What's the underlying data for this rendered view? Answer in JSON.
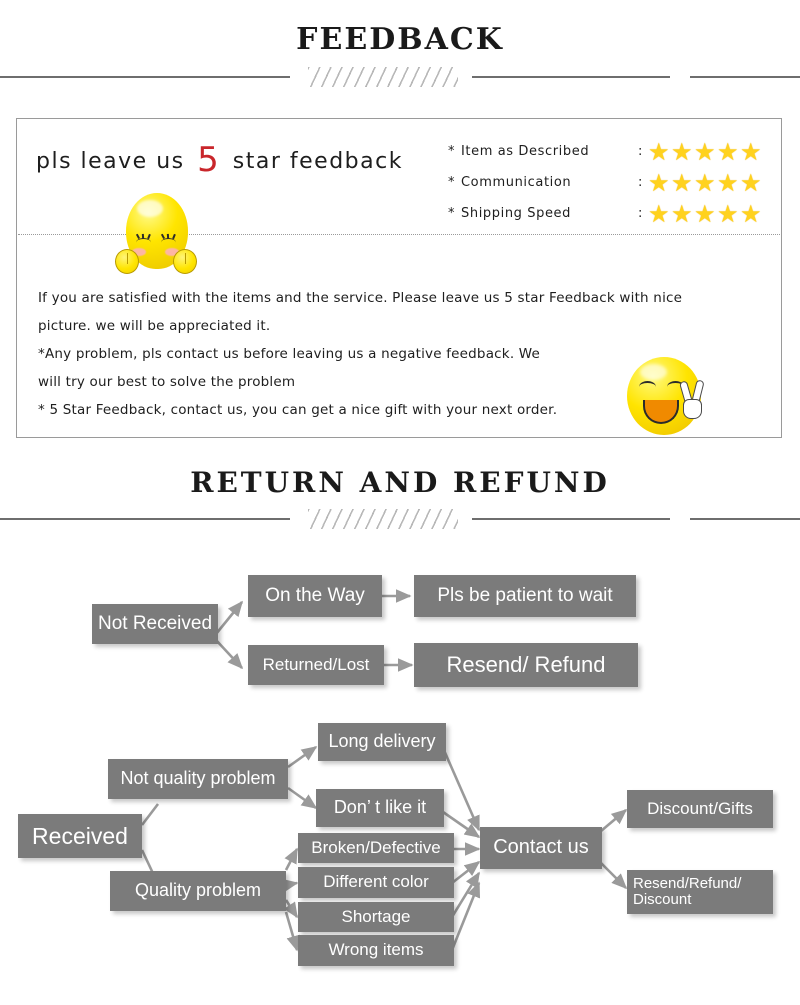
{
  "sections": {
    "feedback": {
      "title": "FEEDBACK",
      "headline_before": "pls leave us",
      "headline_number": "5",
      "headline_after": "star feedback",
      "ratings": [
        {
          "asterisk": "*",
          "label": "Item as Described",
          "colon": ":",
          "stars": 5
        },
        {
          "asterisk": "*",
          "label": "Communication",
          "colon": ":",
          "stars": 5
        },
        {
          "asterisk": "*",
          "label": "Shipping Speed",
          "colon": ":",
          "stars": 5
        }
      ],
      "star_glyph": "★",
      "body_lines": [
        "If you are satisfied with the items and the service. Please leave us 5 star Feedback with nice",
        "picture. we will be appreciated it.",
        "*Any problem, pls contact us before leaving us a negative feedback. We",
        "will try our best to solve  the problem",
        "* 5 Star Feedback, contact us, you can get a nice gift with your next order."
      ]
    },
    "return": {
      "title": "RETURN  AND  REFUND"
    }
  },
  "flow": {
    "nodes": {
      "not_received": "Not Received",
      "on_the_way": "On the Way",
      "pls_be_patient": "Pls be patient to wait",
      "returned_lost": "Returned/Lost",
      "resend_refund": "Resend/ Refund",
      "received": "Received",
      "not_quality": "Not quality problem",
      "quality": "Quality problem",
      "long_delivery": "Long delivery",
      "dont_like": "Don’  t like it",
      "broken": "Broken/Defective",
      "different_color": "Different color",
      "shortage": "Shortage",
      "wrong_items": "Wrong items",
      "contact_us": "Contact us",
      "discount_gifts": "Discount/Gifts",
      "resend_refund_discount": "Resend/Refund/\nDiscount"
    }
  },
  "colors": {
    "node_fill": "#7b7b7b",
    "node_text": "#ffffff",
    "accent_red": "#c9262b",
    "star_yellow": "#ffd21e",
    "divider_gray": "#6e6e6e",
    "box_border": "#9a9a9a"
  }
}
